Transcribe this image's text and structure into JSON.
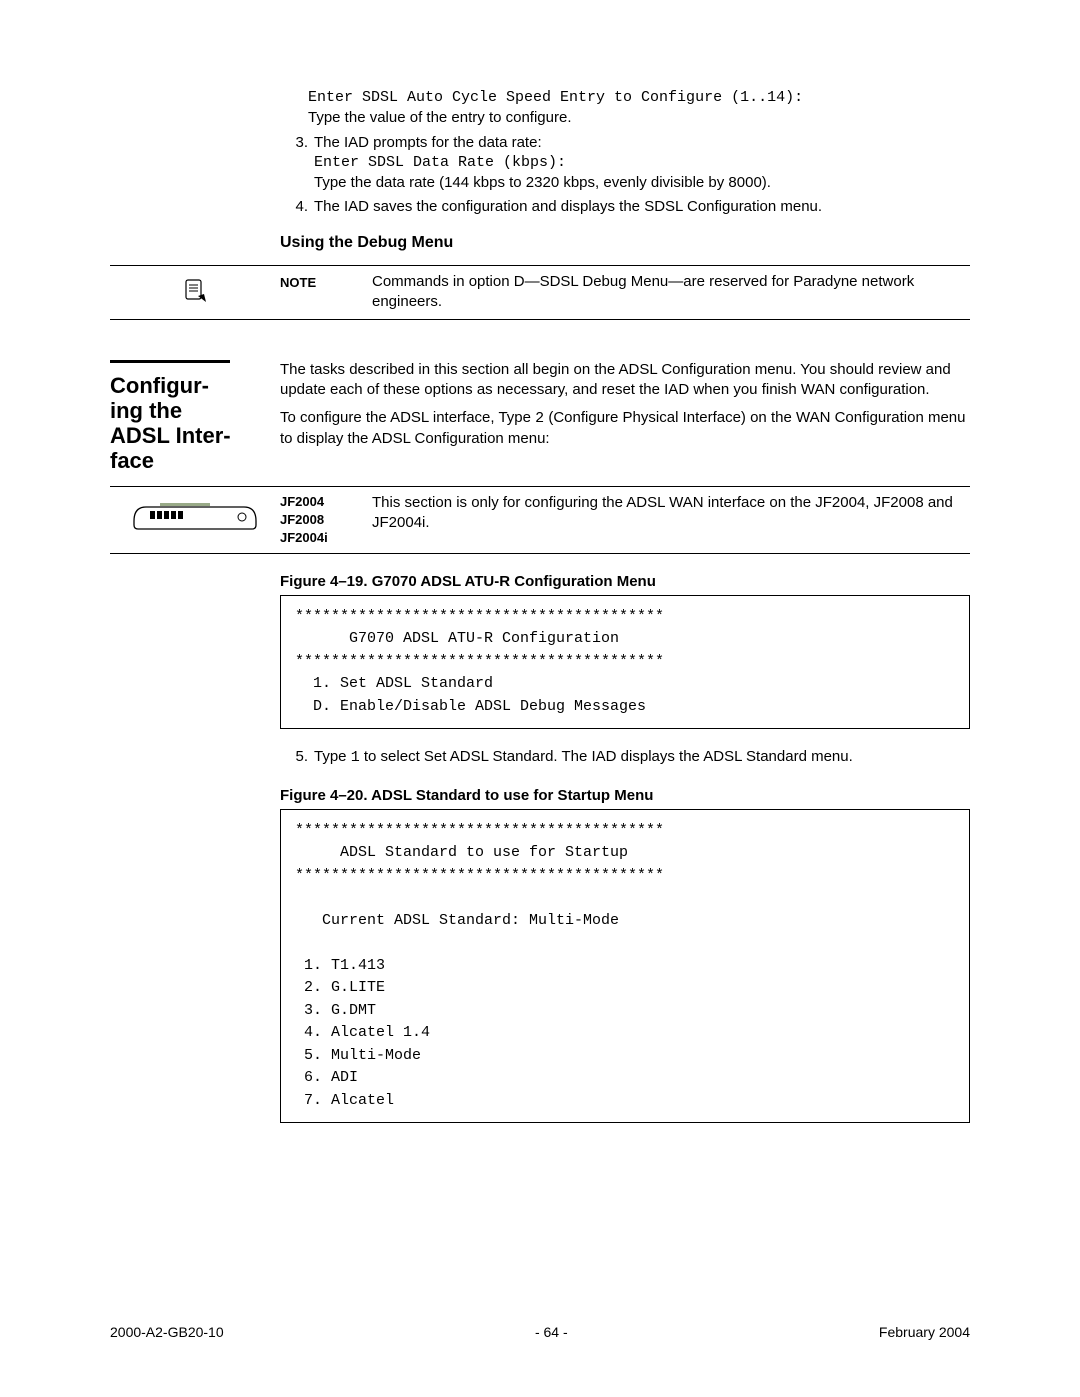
{
  "intro": {
    "prompt1_mono": "Enter SDSL Auto Cycle Speed Entry to Configure (1..14):",
    "prompt1_desc": "Type the value of the entry to configure.",
    "step3_num": "3.",
    "step3_text": "The IAD prompts for the data rate:",
    "step3_mono": "Enter SDSL Data Rate (kbps):",
    "step3_desc": "Type the data rate (144 kbps to 2320 kbps, evenly divisible by 8000).",
    "step4_num": "4.",
    "step4_text": "The IAD saves the configuration and displays the SDSL Configuration menu."
  },
  "debug_heading": "Using the Debug Menu",
  "note": {
    "label": "NOTE",
    "text": "Commands in option D—SDSL Debug Menu—are reserved for Paradyne network engineers."
  },
  "side_heading": "Configur-\ning the\nADSL Inter-\nface",
  "adsl_intro": {
    "p1": "The tasks described in this section all begin on the ADSL Configuration menu. You should review and update each of these options as necessary, and reset the IAD when you finish WAN configuration.",
    "p2a": "To configure the ADSL interface, Type ",
    "p2_code": "2",
    "p2b": " (Configure Physical Interface) on the WAN Configuration menu to display the ADSL Configuration menu:"
  },
  "models": {
    "list": "JF2004\nJF2008\nJF2004i",
    "text": "This section is only for configuring the ADSL WAN interface on the JF2004, JF2008 and JF2004i."
  },
  "fig19": {
    "caption": "Figure 4–19.  G7070 ADSL ATU-R Configuration Menu",
    "body": "*****************************************\n      G7070 ADSL ATU-R Configuration\n*****************************************\n  1. Set ADSL Standard\n  D. Enable/Disable ADSL Debug Messages"
  },
  "step5": {
    "num": "5.",
    "text_a": "Type ",
    "code": "1",
    "text_b": " to select Set ADSL Standard. The IAD displays the ADSL Standard menu."
  },
  "fig20": {
    "caption": "Figure 4–20.  ADSL Standard to use for Startup Menu",
    "body": "*****************************************\n     ADSL Standard to use for Startup\n*****************************************\n\n   Current ADSL Standard: Multi-Mode\n\n 1. T1.413\n 2. G.LITE\n 3. G.DMT\n 4. Alcatel 1.4\n 5. Multi-Mode\n 6. ADI\n 7. Alcatel"
  },
  "footer": {
    "left": "2000-A2-GB20-10",
    "center": "- 64 -",
    "right": "February 2004"
  }
}
